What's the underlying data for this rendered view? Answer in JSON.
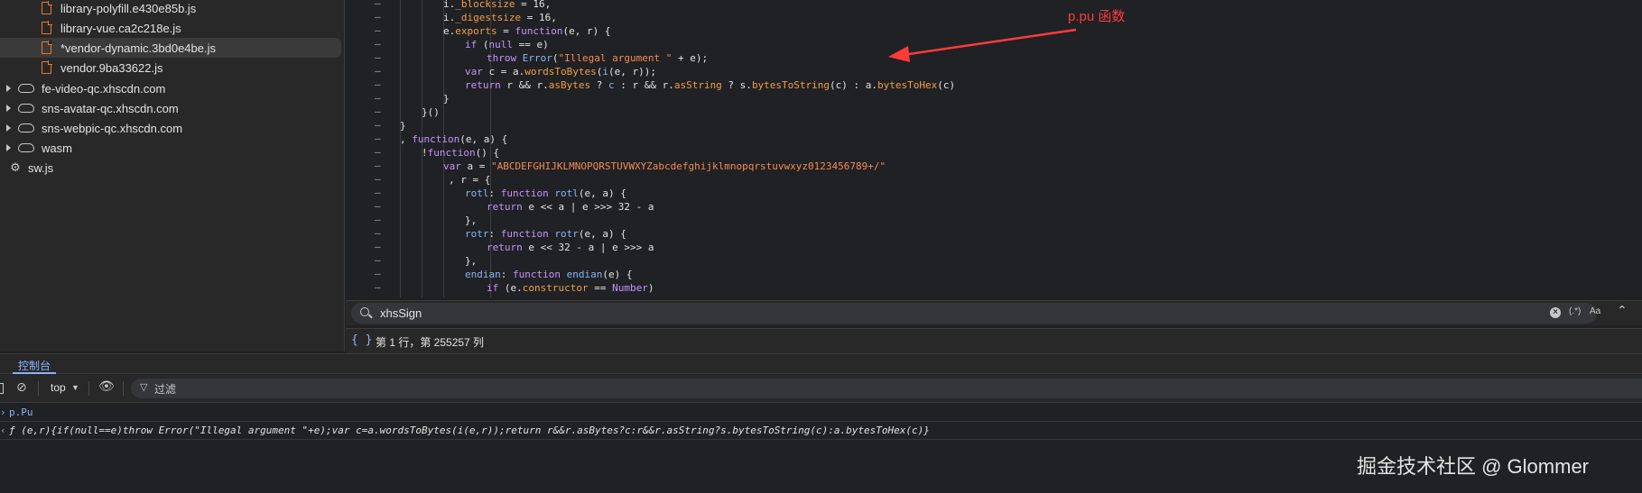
{
  "sidebar": {
    "items": [
      {
        "label": "library-polyfill.e430e85b.js",
        "kind": "file"
      },
      {
        "label": "library-vue.ca2c218e.js",
        "kind": "file"
      },
      {
        "label": "*vendor-dynamic.3bd0e4be.js",
        "kind": "file",
        "selected": true
      },
      {
        "label": "vendor.9ba33622.js",
        "kind": "file"
      },
      {
        "label": "fe-video-qc.xhscdn.com",
        "kind": "domain"
      },
      {
        "label": "sns-avatar-qc.xhscdn.com",
        "kind": "domain"
      },
      {
        "label": "sns-webpic-qc.xhscdn.com",
        "kind": "domain"
      },
      {
        "label": "wasm",
        "kind": "domain"
      },
      {
        "label": "sw.js",
        "kind": "worker"
      }
    ]
  },
  "editor": {
    "gutter_mark": "–",
    "lines": [
      {
        "text": "i._blocksize = 16,"
      },
      {
        "text": "i._digestsize = 16,"
      },
      {
        "text": "e.exports = function(e, r) {"
      },
      {
        "text": "if (null == e)"
      },
      {
        "text": "throw Error(\"Illegal argument \" + e);"
      },
      {
        "text": "var c = a.wordsToBytes(i(e, r));"
      },
      {
        "text": "return r && r.asBytes ? c : r && r.asString ? s.bytesToString(c) : a.bytesToHex(c)"
      },
      {
        "text": "}"
      },
      {
        "text": "}()"
      },
      {
        "text": "}"
      },
      {
        "text": ", function(e, a) {"
      },
      {
        "text": "!function() {"
      },
      {
        "text": "var a = \"ABCDEFGHIJKLMNOPQRSTUVWXYZabcdefghijklmnopqrstuvwxyz0123456789+/\""
      },
      {
        "text": ", r = {"
      },
      {
        "text": "rotl: function rotl(e, a) {"
      },
      {
        "text": "return e << a | e >>> 32 - a"
      },
      {
        "text": "},"
      },
      {
        "text": "rotr: function rotr(e, a) {"
      },
      {
        "text": "return e << 32 - a | e >>> a"
      },
      {
        "text": "},"
      },
      {
        "text": "endian: function endian(e) {"
      },
      {
        "text": "if (e.constructor == Number)"
      }
    ]
  },
  "annotation": {
    "text": "p.pu 函数",
    "color": "#ff3b3b"
  },
  "search": {
    "query": "xhsSign",
    "regex_label": "(.*)",
    "case_label": "Aa",
    "clear": "×",
    "collapse": "⌃"
  },
  "status": {
    "icon": "{ }",
    "text": "第 1 行，第 255257 列"
  },
  "drawer": {
    "tab_console": "控制台"
  },
  "console_toolbar": {
    "context": "top",
    "filter_placeholder": "过滤"
  },
  "console": {
    "input": "p.Pu",
    "output": "ƒ (e,r){if(null==e)throw Error(\"Illegal argument \"+e);var c=a.wordsToBytes(i(e,r));return r&&r.asBytes?c:r&&r.asString?s.bytesToString(c):a.bytesToHex(c)}"
  },
  "watermark": "掘金技术社区 @ Glommer",
  "colors": {
    "accent": "#8ab4f8",
    "file_icon": "#e87a2b",
    "annotation": "#ff3b3b"
  }
}
